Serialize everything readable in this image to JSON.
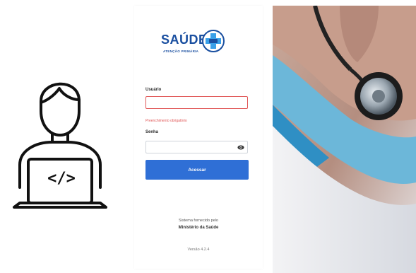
{
  "logo": {
    "brand": "SAÚDE",
    "subtitle": "ATENÇÃO PRIMÁRIA",
    "icon": "health-cross-logo-icon"
  },
  "form": {
    "user_label": "Usuário",
    "user_value": "",
    "user_error": "Preenchimento obrigatório",
    "password_label": "Senha",
    "password_value": "",
    "submit_label": "Acessar"
  },
  "footer": {
    "provided_by": "Sistema fornecido pelo",
    "ministry": "Ministério da Saúde",
    "version": "Versão 4.2.4"
  },
  "colors": {
    "brand_blue": "#1a4fa0",
    "button_blue": "#2f6fd6",
    "error_red": "#e05555"
  },
  "illustration": {
    "icon": "developer-laptop-icon",
    "code_symbol": "</>"
  }
}
